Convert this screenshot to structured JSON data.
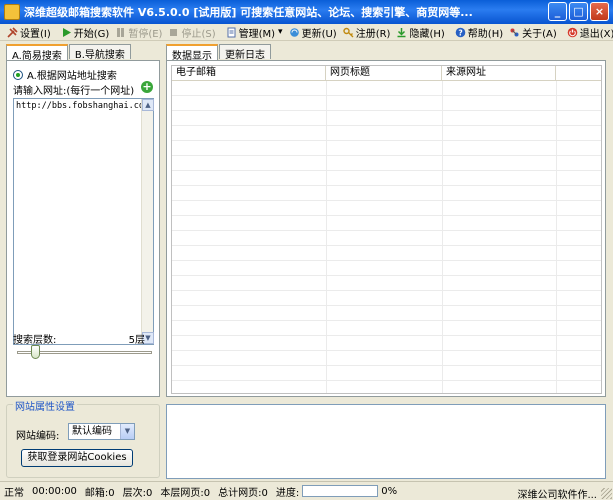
{
  "window": {
    "title": "深维超级邮箱搜索软件 V6.5.0.0 [试用版] 可搜索任意网站、论坛、搜索引擎、商贸网等...",
    "min_glyph": "_",
    "max_glyph": "□",
    "close_glyph": "×"
  },
  "toolbar": {
    "settings": "设置(I)",
    "start": "开始(G)",
    "pause": "暂停(E)",
    "stop": "停止(S)",
    "manage": "管理(M)",
    "manage_arrow": "▾",
    "update": "更新(U)",
    "register": "注册(R)",
    "hide": "隐藏(H)",
    "help": "帮助(H)",
    "about": "关于(A)",
    "exit": "退出(X)"
  },
  "left_tabs": {
    "simple": "A.简易搜索",
    "nav": "B.导航搜索"
  },
  "search": {
    "mode_label": "A.根据网站地址搜索",
    "url_prompt": "请输入网址:(每行一个网址)",
    "add_glyph": "+",
    "url_text": "http://bbs.fobshanghai.com/",
    "scroll_up": "▲",
    "scroll_down": "▼",
    "depth_label": "搜索层数:",
    "depth_value": "5层"
  },
  "site_settings": {
    "legend": "网站属性设置",
    "encoding_label": "网站编码:",
    "encoding_value": "默认编码",
    "select_arrow": "▼",
    "cookie_button": "获取登录网站Cookies"
  },
  "right_tabs": {
    "data": "数据显示",
    "log": "更新日志"
  },
  "grid": {
    "columns": [
      "电子邮箱",
      "网页标题",
      "来源网址"
    ]
  },
  "status": {
    "state": "正常",
    "time": "00:00:00",
    "mailbox": "邮箱:0",
    "layer": "层次:0",
    "layer_pages": "本层网页:0",
    "total_pages": "总计网页:0",
    "progress_label": "进度:",
    "progress_value": "0%",
    "progress_fraction": 0,
    "company": "深维公司软件作..."
  },
  "colors": {
    "title_bar": "#0a5fd8",
    "toolbar_bg": "#ece9d8",
    "legend": "#2157c7",
    "add_icon": "#3aa63a"
  },
  "icons": {
    "settings": "wrench-icon",
    "start": "play-icon",
    "pause": "pause-icon",
    "stop": "stop-icon",
    "manage": "document-icon",
    "update": "refresh-icon",
    "register": "key-icon",
    "hide": "download-icon",
    "help": "help-icon",
    "about": "about-icon",
    "exit": "exit-icon"
  }
}
